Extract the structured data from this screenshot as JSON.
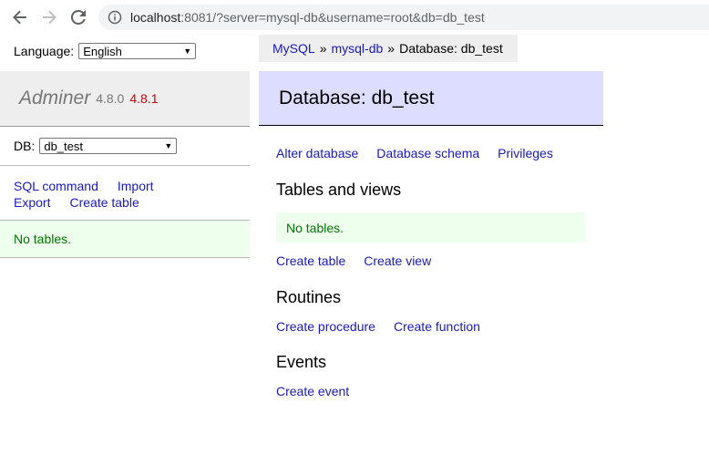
{
  "browser": {
    "url_host": "localhost",
    "url_rest": ":8081/?server=mysql-db&username=root&db=db_test"
  },
  "sidebar": {
    "language_label": "Language:",
    "language_value": "English",
    "app_name": "Adminer",
    "version": "4.8.0",
    "new_version": "4.8.1",
    "db_label": "DB:",
    "db_value": "db_test",
    "links": [
      "SQL command",
      "Import",
      "Export",
      "Create table"
    ],
    "no_tables": "No tables."
  },
  "breadcrumb": {
    "items": [
      "MySQL",
      "mysql-db"
    ],
    "separator": "»",
    "current": "Database: db_test"
  },
  "main": {
    "title": "Database: db_test",
    "top_links": [
      "Alter database",
      "Database schema",
      "Privileges"
    ],
    "tables_heading": "Tables and views",
    "no_tables": "No tables.",
    "table_links": [
      "Create table",
      "Create view"
    ],
    "routines_heading": "Routines",
    "routine_links": [
      "Create procedure",
      "Create function"
    ],
    "events_heading": "Events",
    "event_links": [
      "Create event"
    ]
  }
}
